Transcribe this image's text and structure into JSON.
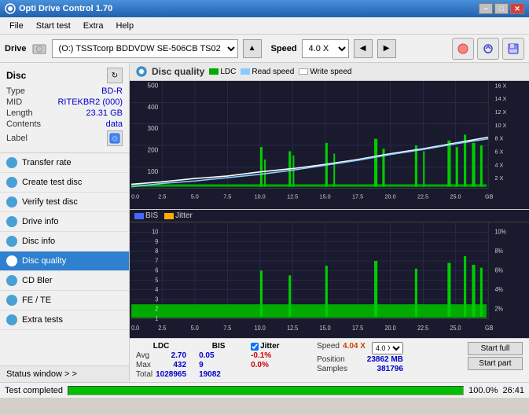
{
  "titleBar": {
    "title": "Opti Drive Control 1.70",
    "minimizeLabel": "−",
    "maximizeLabel": "□",
    "closeLabel": "✕"
  },
  "menuBar": {
    "items": [
      "File",
      "Start test",
      "Extra",
      "Help"
    ]
  },
  "toolbar": {
    "driveLabel": "Drive",
    "driveValue": "(O:)  TSSTcorp BDDVDW SE-506CB TS02",
    "speedLabel": "Speed",
    "speedValue": "4.0 X"
  },
  "disc": {
    "title": "Disc",
    "typeLabel": "Type",
    "typeValue": "BD-R",
    "midLabel": "MID",
    "midValue": "RITEKBR2 (000)",
    "lengthLabel": "Length",
    "lengthValue": "23.31 GB",
    "contentsLabel": "Contents",
    "contentsValue": "data",
    "labelLabel": "Label"
  },
  "navItems": [
    {
      "id": "transfer-rate",
      "label": "Transfer rate"
    },
    {
      "id": "create-test-disc",
      "label": "Create test disc"
    },
    {
      "id": "verify-test-disc",
      "label": "Verify test disc"
    },
    {
      "id": "drive-info",
      "label": "Drive info"
    },
    {
      "id": "disc-info",
      "label": "Disc info"
    },
    {
      "id": "disc-quality",
      "label": "Disc quality",
      "active": true
    },
    {
      "id": "cd-bler",
      "label": "CD Bler"
    },
    {
      "id": "fe-te",
      "label": "FE / TE"
    },
    {
      "id": "extra-tests",
      "label": "Extra tests"
    }
  ],
  "statusWindow": {
    "label": "Status window > >"
  },
  "chartTitle": "Disc quality",
  "legend": {
    "ldc": "LDC",
    "readSpeed": "Read speed",
    "writeSpeed": "Write speed",
    "bis": "BIS",
    "jitter": "Jitter"
  },
  "topChart": {
    "yMax": 500,
    "yMin": 0,
    "xMax": 25,
    "yRightMax": "16 X",
    "yLabels": [
      "500",
      "400",
      "300",
      "200",
      "100"
    ],
    "xLabels": [
      "0.0",
      "2.5",
      "5.0",
      "7.5",
      "10.0",
      "12.5",
      "15.0",
      "17.5",
      "20.0",
      "22.5",
      "25.0"
    ],
    "rightLabels": [
      "16 X",
      "14 X",
      "12 X",
      "10 X",
      "8 X",
      "6 X",
      "4 X",
      "2 X"
    ]
  },
  "bottomChart": {
    "yMax": 10,
    "yMin": 0,
    "xMax": 25,
    "yLabels": [
      "10",
      "9",
      "8",
      "7",
      "6",
      "5",
      "4",
      "3",
      "2",
      "1"
    ],
    "xLabels": [
      "0.0",
      "2.5",
      "5.0",
      "7.5",
      "10.0",
      "12.5",
      "15.0",
      "17.5",
      "20.0",
      "22.5",
      "25.0"
    ],
    "rightLabels": [
      "10%",
      "8%",
      "6%",
      "4%",
      "2%"
    ]
  },
  "stats": {
    "ldcLabel": "LDC",
    "bisLabel": "BIS",
    "jitterLabel": "Jitter",
    "speedLabel": "Speed",
    "positionLabel": "Position",
    "samplesLabel": "Samples",
    "avgLabel": "Avg",
    "maxLabel": "Max",
    "totalLabel": "Total",
    "ldcAvg": "2.70",
    "ldcMax": "432",
    "ldcTotal": "1028965",
    "bisAvg": "0.05",
    "bisMax": "9",
    "bisTotal": "19082",
    "jitterAvg": "-0.1%",
    "jitterMax": "0.0%",
    "speedValue": "4.04 X",
    "speedSelect": "4.0 X",
    "positionValue": "23862 MB",
    "samplesValue": "381796",
    "startFullLabel": "Start full",
    "startPartLabel": "Start part"
  },
  "bottomStatus": {
    "testCompleted": "Test completed",
    "progressPercent": "100.0%",
    "timeValue": "26:41"
  }
}
